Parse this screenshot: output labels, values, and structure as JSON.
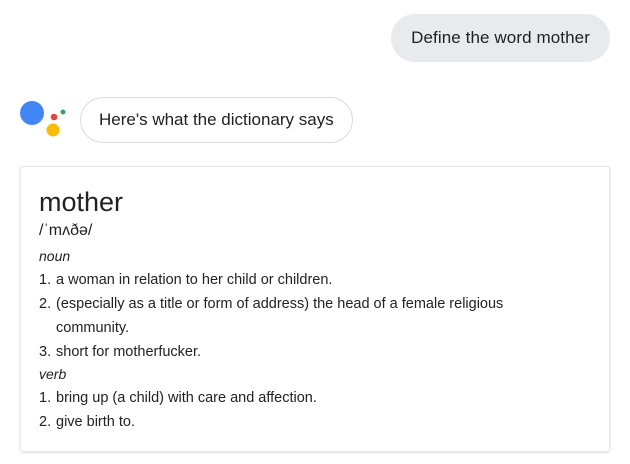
{
  "conversation": {
    "user_query": "Define the word mother",
    "assistant_reply": "Here's what the dictionary says"
  },
  "dictionary": {
    "word": "mother",
    "phonetic": "/ˈmʌðə/",
    "entries": [
      {
        "part_of_speech": "noun",
        "definitions": [
          {
            "num": "1.",
            "text": "a woman in relation to her child or children."
          },
          {
            "num": "2.",
            "text": "(especially as a title or form of address) the head of a female religious community."
          },
          {
            "num": "3.",
            "text": "short for motherfucker."
          }
        ]
      },
      {
        "part_of_speech": "verb",
        "definitions": [
          {
            "num": "1.",
            "text": "bring up (a child) with care and affection."
          },
          {
            "num": "2.",
            "text": "give birth to."
          }
        ]
      }
    ]
  },
  "icons": {
    "assistant_logo": "google-assistant-icon"
  },
  "colors": {
    "assistant_blue": "#4285f4",
    "assistant_red": "#ea4335",
    "assistant_yellow": "#fbbc05",
    "assistant_green": "#34a853",
    "user_bubble_bg": "#e9eaed"
  }
}
